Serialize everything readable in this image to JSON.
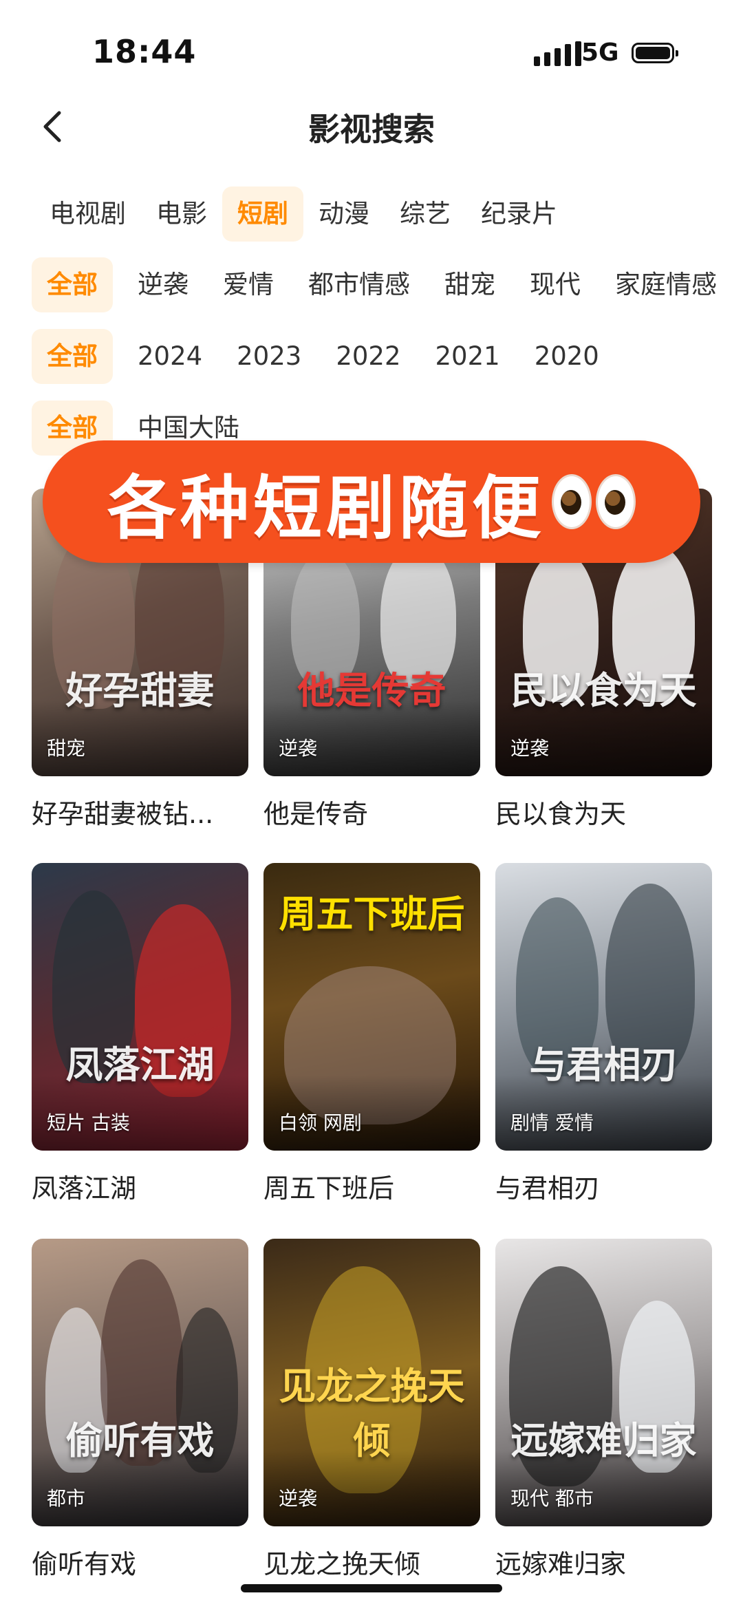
{
  "status_bar": {
    "time": "18:44",
    "network": "5G"
  },
  "header": {
    "title": "影视搜索"
  },
  "category_tabs": [
    {
      "label": "电视剧",
      "active": false
    },
    {
      "label": "电影",
      "active": false
    },
    {
      "label": "短剧",
      "active": true
    },
    {
      "label": "动漫",
      "active": false
    },
    {
      "label": "综艺",
      "active": false
    },
    {
      "label": "纪录片",
      "active": false
    }
  ],
  "genre_filters": [
    "全部",
    "逆袭",
    "爱情",
    "都市情感",
    "甜宠",
    "现代",
    "家庭情感"
  ],
  "year_filters": [
    "全部",
    "2024",
    "2023",
    "2022",
    "2021",
    "2020"
  ],
  "region_filters": [
    "全部",
    "中国大陆"
  ],
  "banner": {
    "text": "各种短剧随便"
  },
  "items": [
    {
      "title": "好孕甜妻被钻...",
      "tags": "甜宠",
      "poster_text": "好孕甜妻"
    },
    {
      "title": "他是传奇",
      "tags": "逆袭",
      "poster_text": "他是传奇"
    },
    {
      "title": "民以食为天",
      "tags": "逆袭",
      "poster_text": "民以食为天"
    },
    {
      "title": "凤落江湖",
      "tags": "短片 古装",
      "poster_text": "凤落江湖"
    },
    {
      "title": "周五下班后",
      "tags": "白领 网剧",
      "poster_text": "周五下班后"
    },
    {
      "title": "与君相刃",
      "tags": "剧情 爱情",
      "poster_text": "与君相刃"
    },
    {
      "title": "偷听有戏",
      "tags": "都市",
      "poster_text": "偷听有戏"
    },
    {
      "title": "见龙之挽天倾",
      "tags": "逆袭",
      "poster_text": "见龙之挽天倾"
    },
    {
      "title": "远嫁难归家",
      "tags": "现代 都市",
      "poster_text": "远嫁难归家"
    }
  ],
  "colors": {
    "accent": "#ff8a00",
    "accent_bg": "#fff3e2",
    "banner": "#f5501e"
  }
}
